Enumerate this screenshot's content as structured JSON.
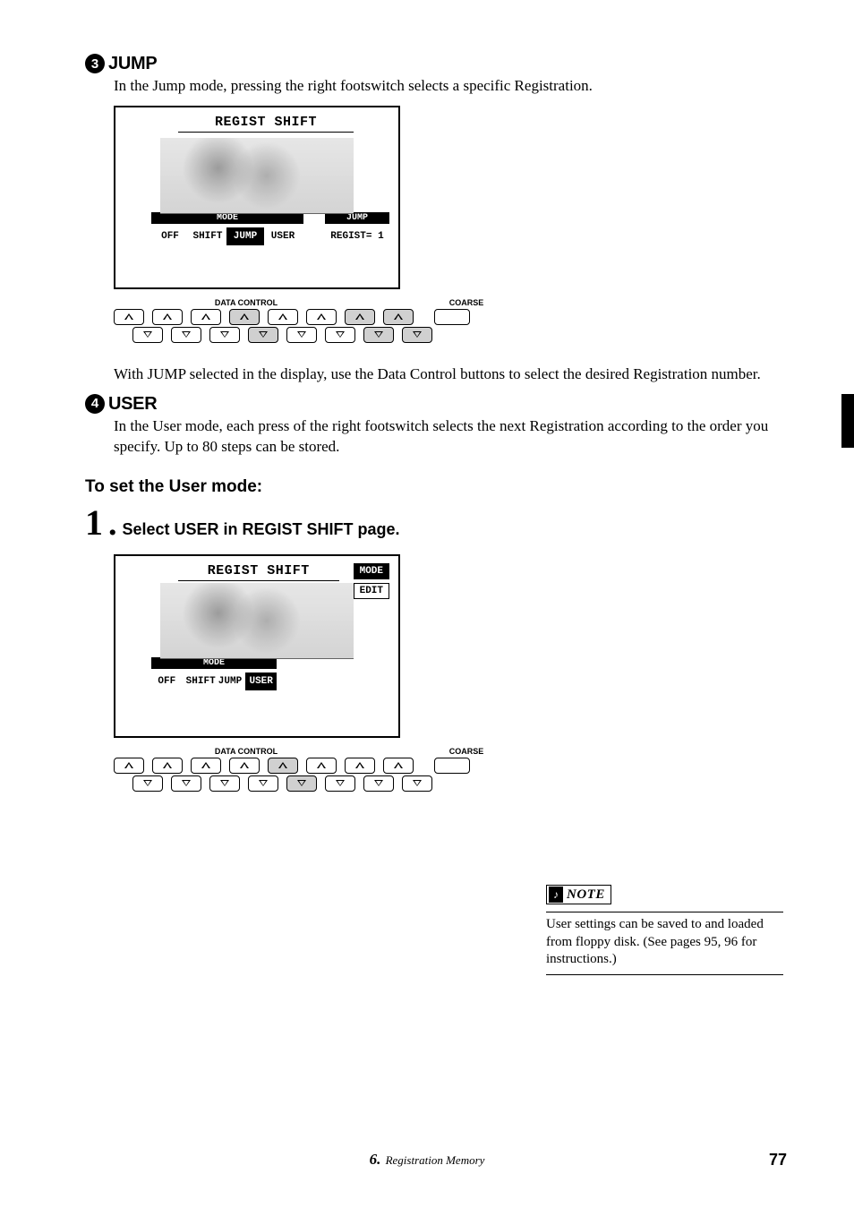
{
  "section3": {
    "num": "3",
    "title": "JUMP",
    "body": "In the Jump mode, pressing the right footswitch selects a specific Registration.",
    "lcd": {
      "title": "REGIST SHIFT",
      "mode_label": "MODE",
      "jump_label": "JUMP",
      "options": [
        "OFF",
        "SHIFT",
        "JUMP",
        "USER"
      ],
      "selected": "JUMP",
      "jump_value": "REGIST= 1"
    },
    "after": "With JUMP selected in the display, use the Data Control buttons to select the desired Registration number."
  },
  "section4": {
    "num": "4",
    "title": "USER",
    "body": "In the User mode, each press of the right footswitch selects the next Registration according to the order you specify.  Up to 80 steps can be stored."
  },
  "usermode": {
    "heading": "To set the User mode:",
    "step_num": "1",
    "step_text": "Select USER in REGIST SHIFT page.",
    "lcd": {
      "title": "REGIST SHIFT",
      "page_mode": "MODE",
      "page_edit": "EDIT",
      "mode_label": "MODE",
      "options": [
        "OFF",
        "SHIFT",
        "JUMP",
        "USER"
      ],
      "selected": "USER"
    }
  },
  "dc": {
    "label": "DATA CONTROL",
    "coarse": "COARSE"
  },
  "note": {
    "label": "NOTE",
    "text": "User settings can be saved to and loaded from floppy disk.  (See pages 95, 96 for instructions.)"
  },
  "footer": {
    "chapter_num": "6.",
    "chapter_title": "Registration Memory",
    "page": "77"
  }
}
